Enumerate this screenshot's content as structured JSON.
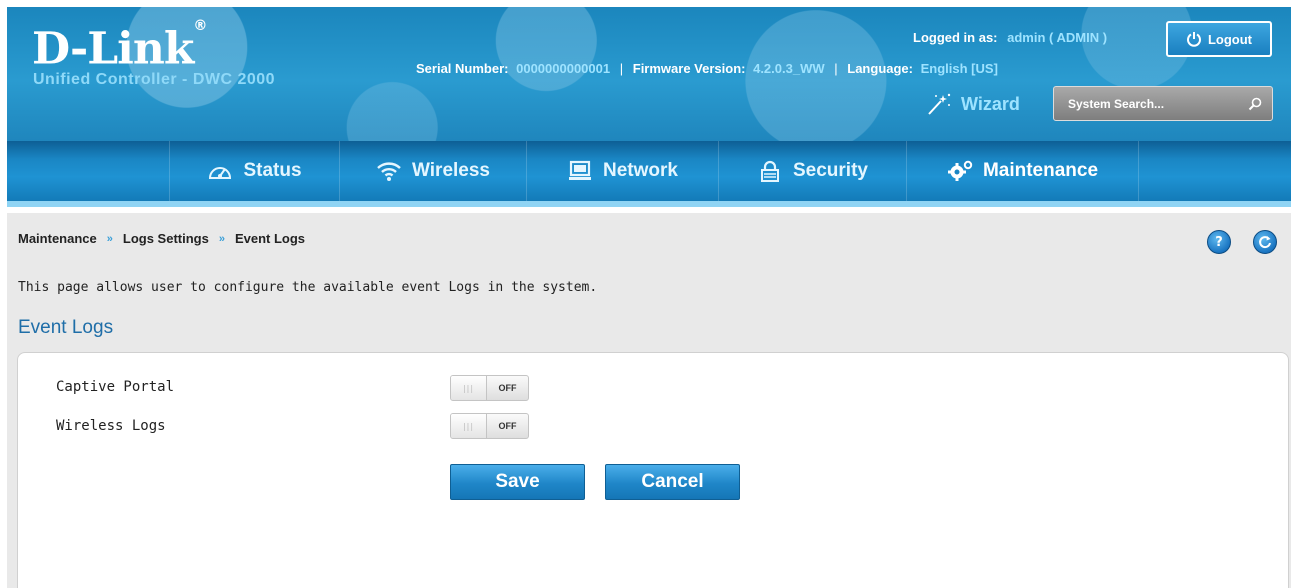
{
  "header": {
    "logo_text": "D-Link",
    "logo_mark": "®",
    "product": "Unified Controller - DWC 2000",
    "logged_in_label": "Logged in as:",
    "logged_in_value": "admin ( ADMIN )",
    "logout_label": "Logout",
    "serial_label": "Serial Number:",
    "serial_value": "0000000000001",
    "firmware_label": "Firmware Version:",
    "firmware_value": "4.2.0.3_WW",
    "language_label": "Language:",
    "language_value": "English [US]",
    "wizard_label": "Wizard",
    "search_placeholder": "System Search..."
  },
  "nav": {
    "items": [
      {
        "label": "Status",
        "icon": "gauge-icon"
      },
      {
        "label": "Wireless",
        "icon": "wifi-icon"
      },
      {
        "label": "Network",
        "icon": "monitor-icon"
      },
      {
        "label": "Security",
        "icon": "lock-icon"
      },
      {
        "label": "Maintenance",
        "icon": "gears-icon",
        "active": true
      }
    ]
  },
  "breadcrumb": {
    "items": [
      "Maintenance",
      "Logs Settings",
      "Event Logs"
    ],
    "separator": "»"
  },
  "page": {
    "description": "This page allows user to configure the available event Logs in the system.",
    "section_title": "Event Logs",
    "help_icon_text": "?",
    "refresh_icon": "refresh-icon"
  },
  "settings": [
    {
      "label": "Captive Portal",
      "state": "OFF"
    },
    {
      "label": "Wireless Logs",
      "state": "OFF"
    }
  ],
  "actions": {
    "save_label": "Save",
    "cancel_label": "Cancel"
  },
  "colors": {
    "header_blue": "#1f8fc6",
    "accent_light": "#9ee3ff",
    "section_title": "#1f6ea8",
    "content_bg": "#e9e9e9"
  }
}
